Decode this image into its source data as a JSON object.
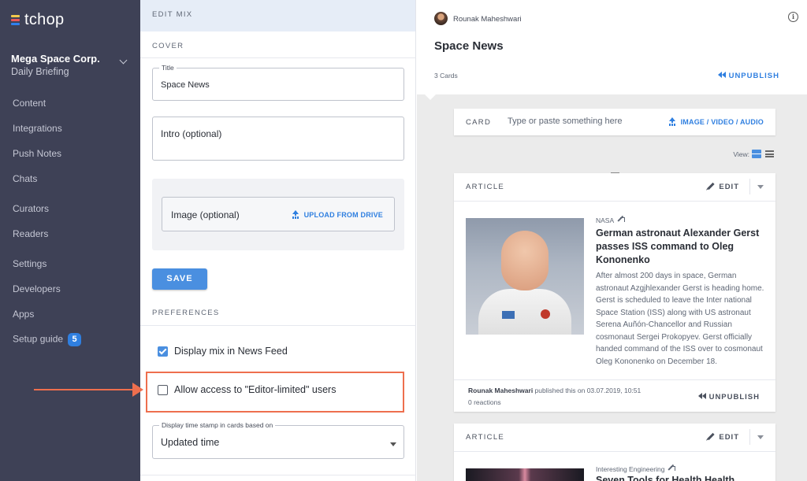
{
  "sidebar": {
    "logo": "tchop",
    "org_name": "Mega Space Corp.",
    "org_sub": "Daily Briefing",
    "items": [
      {
        "label": "Content"
      },
      {
        "label": "Integrations"
      },
      {
        "label": "Push Notes"
      },
      {
        "label": "Chats"
      },
      {
        "label": "Curators"
      },
      {
        "label": "Readers"
      },
      {
        "label": "Settings"
      },
      {
        "label": "Developers"
      },
      {
        "label": "Apps"
      },
      {
        "label": "Setup guide",
        "badge": "5"
      }
    ]
  },
  "editor": {
    "header": "EDIT MIX",
    "cover_label": "COVER",
    "title_legend": "Title",
    "title_value": "Space News",
    "intro_placeholder": "Intro (optional)",
    "image_label": "Image (optional)",
    "upload_label": "UPLOAD FROM DRIVE",
    "save_label": "SAVE",
    "preferences_label": "PREFERENCES",
    "checkbox_feed": "Display mix in News Feed",
    "checkbox_editor": "Allow access to \"Editor-limited\" users",
    "timestamp_legend": "Display time stamp in cards based on",
    "timestamp_value": "Updated time"
  },
  "preview": {
    "user": "Rounak Maheshwari",
    "title": "Space News",
    "card_count": "3 Cards",
    "unpublish": "UNPUBLISH",
    "card_label": "CARD",
    "card_placeholder": "Type or paste something here",
    "media_label": "IMAGE / VIDEO / AUDIO",
    "view_label": "View:",
    "article1": {
      "type_label": "ARTICLE",
      "edit_label": "EDIT",
      "source": "NASA",
      "headline": "German astronaut Alexander Gerst passes ISS command to Oleg Kononenko",
      "body": "After almost 200 days in space, German astronaut Azgjhlexander Gerst is heading home. Gerst is scheduled to leave the Inter national Space Station (ISS) along with US astronaut Serena Auñón-Chancellor and Russian cosmonaut Sergei Prokopyev. Gerst officially handed command of the ISS over to cosmonaut Oleg Kononenko on December 18.",
      "author": "Rounak Maheshwari",
      "published_text": " published this on 03.07.2019, 10:51",
      "reactions": "0 reactions",
      "unpublish": "UNPUBLISH"
    },
    "article2": {
      "type_label": "ARTICLE",
      "edit_label": "EDIT",
      "source": "Interesting Engineering",
      "headline": "Seven Tools for Health Health"
    }
  },
  "colors": {
    "sidebar_bg": "#3e4156",
    "accent_blue": "#2f7fe0",
    "highlight_orange": "#ee6f4e",
    "preview_bg": "#ebebeb"
  },
  "icons": {
    "org_toggle": "chevron-down-icon",
    "upload": "upload-icon",
    "info": "info-icon",
    "unpublish": "double-arrow-left-icon",
    "edit": "pencil-icon",
    "view_grid": "grid-view-icon",
    "view_list": "list-view-icon",
    "source_link": "external-link-icon"
  }
}
